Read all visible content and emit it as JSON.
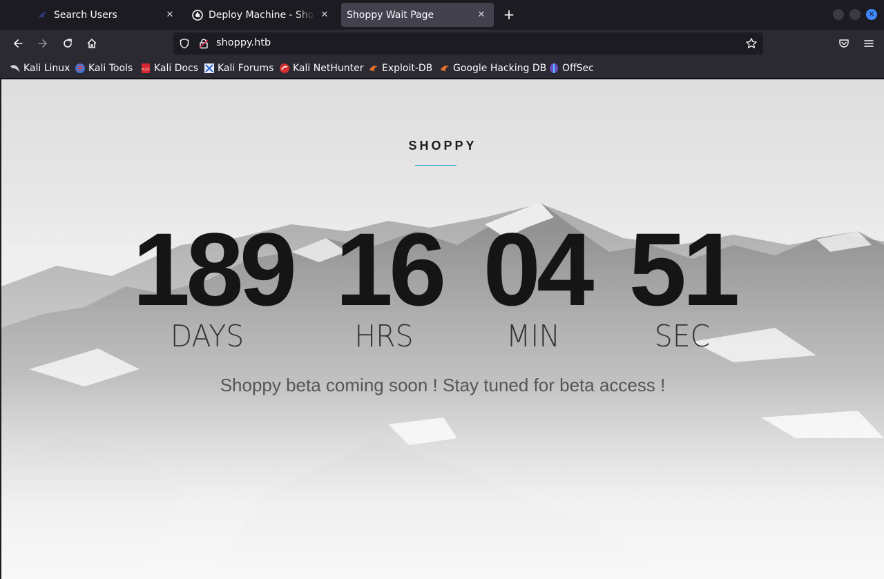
{
  "browser": {
    "tabs": [
      {
        "label": "Search Users",
        "active": false,
        "icon": "kali-dragon-icon"
      },
      {
        "label": "Deploy Machine - Shoppy",
        "active": false,
        "icon": "hackthebox-icon"
      },
      {
        "label": "Shoppy Wait Page",
        "active": true,
        "icon": ""
      }
    ],
    "url": "shoppy.htb",
    "bookmarks": [
      {
        "label": "Kali Linux",
        "icon": "kali-dragon-icon"
      },
      {
        "label": "Kali Tools",
        "icon": "kali-tools-icon"
      },
      {
        "label": "Kali Docs",
        "icon": "kali-docs-icon"
      },
      {
        "label": "Kali Forums",
        "icon": "kali-forums-icon"
      },
      {
        "label": "Kali NetHunter",
        "icon": "nethunter-icon"
      },
      {
        "label": "Exploit-DB",
        "icon": "exploit-db-icon"
      },
      {
        "label": "Google Hacking DB",
        "icon": "ghdb-icon"
      },
      {
        "label": "OffSec",
        "icon": "offsec-icon"
      }
    ]
  },
  "page": {
    "title": "SHOPPY",
    "countdown": [
      {
        "value": "189",
        "unit": "DAYS"
      },
      {
        "value": "16",
        "unit": "HRS"
      },
      {
        "value": "04",
        "unit": "MIN"
      },
      {
        "value": "51",
        "unit": "SEC"
      }
    ],
    "tagline": "Shoppy beta coming soon ! Stay tuned for beta access !"
  },
  "colors": {
    "accent_underline": "#17a2b8",
    "chrome_dark": "#1c1b22",
    "chrome_toolbar": "#2b2a33",
    "active_tab": "#42414d"
  }
}
